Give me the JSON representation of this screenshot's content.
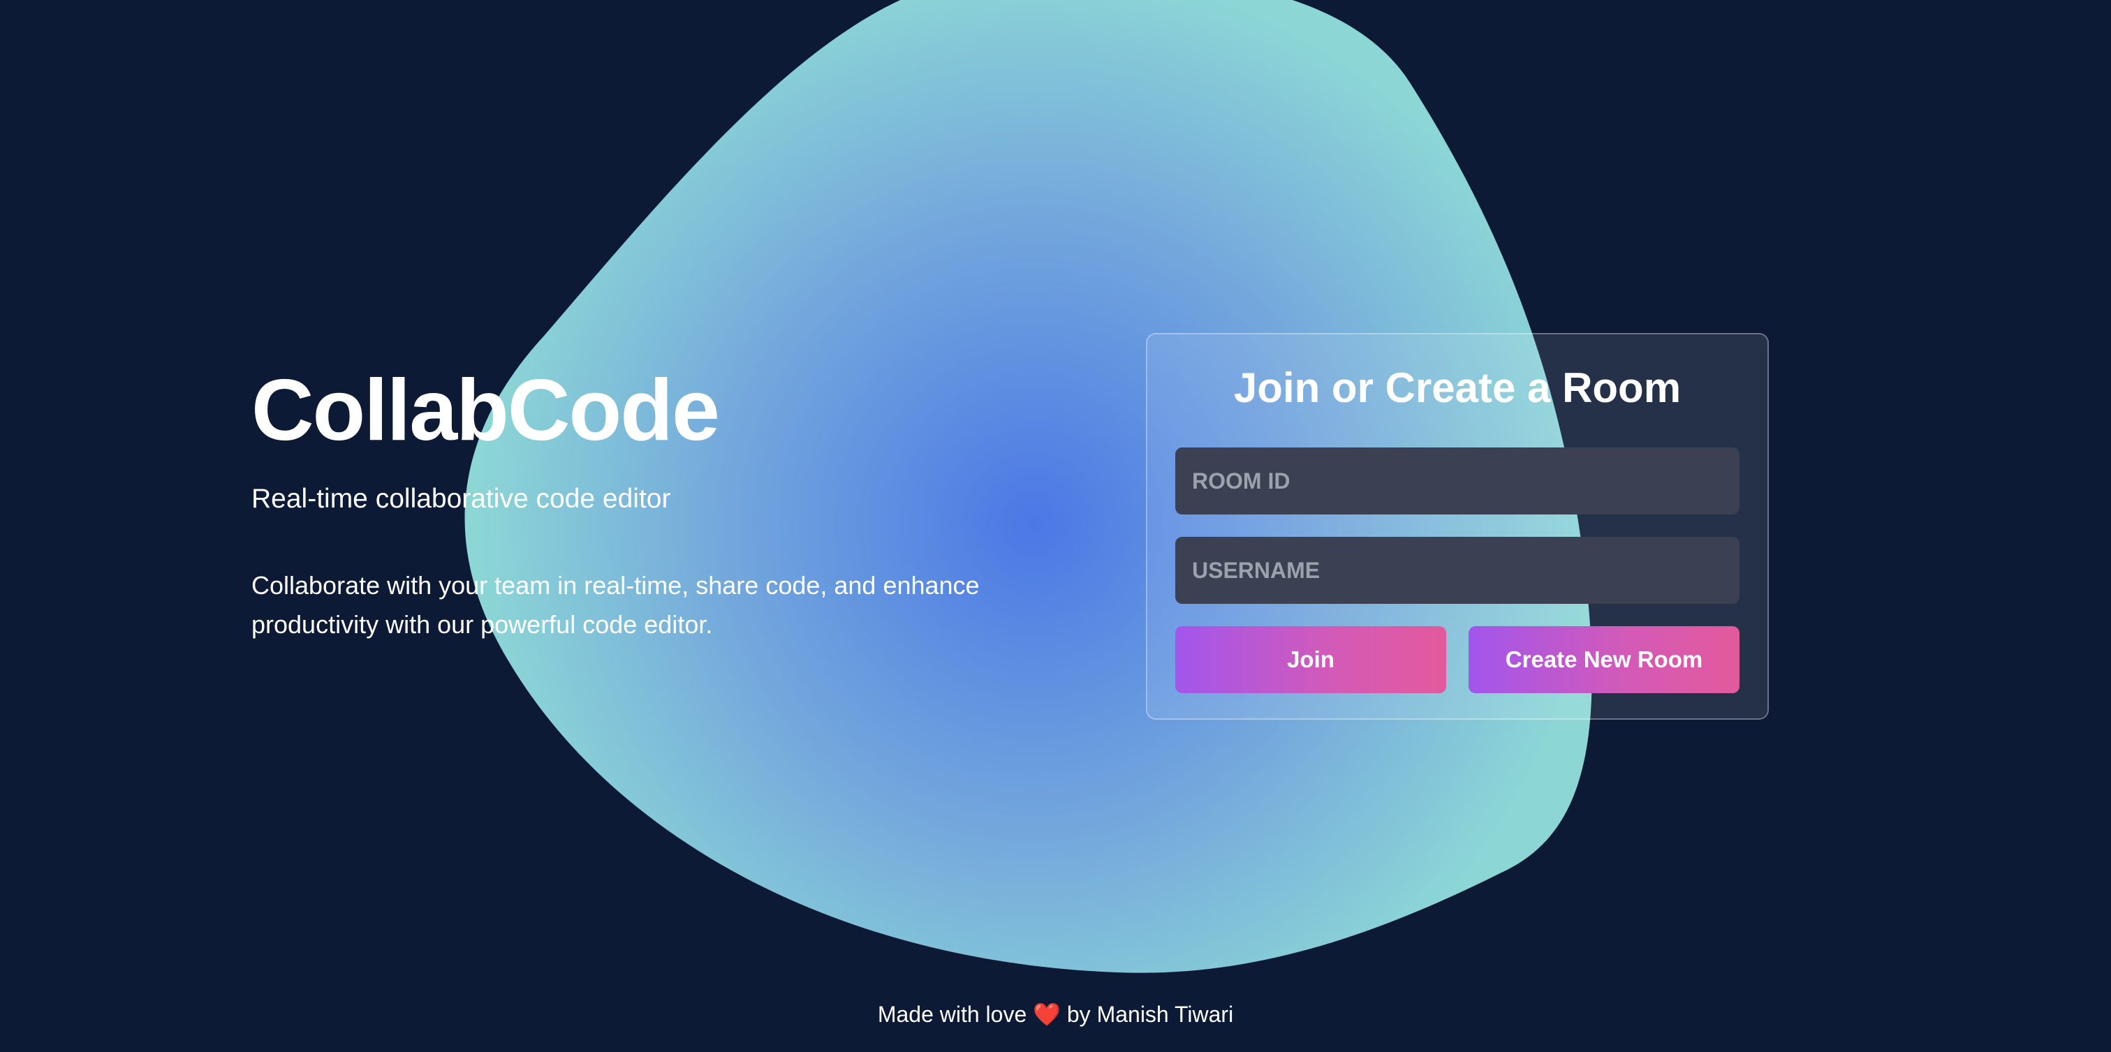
{
  "hero": {
    "title": "CollabCode",
    "subtitle": "Real-time collaborative code editor",
    "description": "Collaborate with your team in real-time, share code, and enhance productivity with our powerful code editor."
  },
  "card": {
    "title": "Join or Create a Room",
    "room_id_placeholder": "ROOM ID",
    "username_placeholder": "USERNAME",
    "join_label": "Join",
    "create_label": "Create New Room"
  },
  "footer": {
    "prefix": "Made with love",
    "heart": "❤️",
    "suffix": "by Manish Tiwari"
  },
  "colors": {
    "background": "#0c1a35",
    "blob_center": "#4a78e6",
    "blob_edge": "#8cd6d6",
    "button_gradient_start": "#a256ec",
    "button_gradient_end": "#e35a9c",
    "input_background": "#3b4152"
  }
}
